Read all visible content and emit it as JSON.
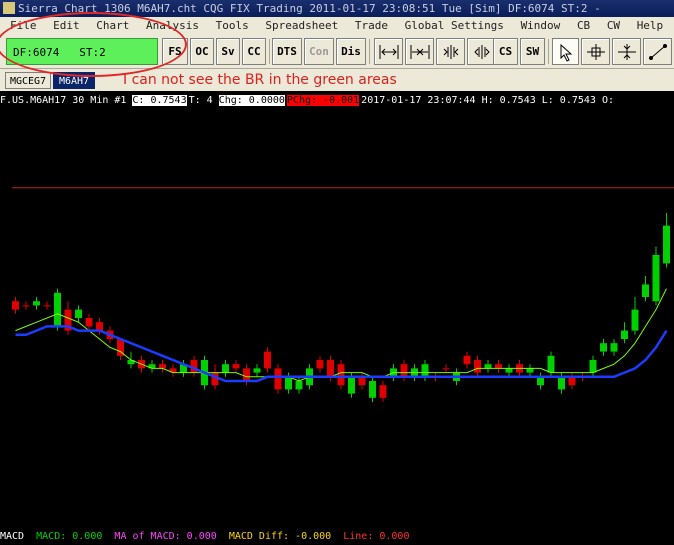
{
  "window": {
    "title": "Sierra Chart 1306 M6AH7.cht  CQG FIX Trading 2011-01-17  23:08:51 Tue [Sim]  DF:6074  ST:2 -"
  },
  "menu": [
    "File",
    "Edit",
    "Chart",
    "Analysis",
    "Tools",
    "Spreadsheet",
    "Trade",
    "Global Settings",
    "Window",
    "CB",
    "CW",
    "Help"
  ],
  "status": {
    "df": "DF:6074",
    "st": "ST:2"
  },
  "toolbar": {
    "fs": "FS",
    "oc": "OC",
    "sv": "Sv",
    "cc": "CC",
    "dts": "DTS",
    "con": "Con",
    "dis": "Dis",
    "cs": "CS",
    "sw": "SW"
  },
  "icons": {
    "expand_both": "arrows-out-icon",
    "expand_one": "arrows-in-icon",
    "zoom_in": "bar-spacing-increase-icon",
    "zoom_out": "bar-spacing-decrease-icon",
    "pointer": "cursor-pointer-icon",
    "crosshair": "crosshair-icon",
    "value": "value-tool-icon",
    "line": "line-draw-icon"
  },
  "tabs": [
    "MGCEG7",
    "M6AH7"
  ],
  "annotation_note": "I can not see the BR in the green areas",
  "chart_header": {
    "symbol": "F.US.M6AH17",
    "interval": "30 Min",
    "number": "#1",
    "close": "C: 0.7543",
    "trades": "T: 4",
    "change": "Chg: 0.0000",
    "pct_change": "PChg: -0.001",
    "datetime": "2017-01-17 23:07:44",
    "high": "H: 0.7543",
    "low": "L: 0.7543",
    "open": "O:"
  },
  "colors": {
    "up": "#00d000",
    "down": "#e00000",
    "ma_fast": "#7cfc00",
    "ma_slow": "#1a3cff",
    "hline": "#c02020",
    "green_status": "#5ef05a"
  },
  "macd": {
    "label": "MACD",
    "macd": "MACD: 0.000",
    "ma": "MA of MACD: 0.000",
    "diff": "MACD Diff: -0.000",
    "line": "Line: 0.000"
  },
  "chart_data": {
    "type": "candlestick",
    "open": [
      0.46,
      0.47,
      0.47,
      0.47,
      0.52,
      0.48,
      0.5,
      0.5,
      0.51,
      0.53,
      0.55,
      0.61,
      0.6,
      0.62,
      0.61,
      0.62,
      0.63,
      0.6,
      0.66,
      0.63,
      0.63,
      0.61,
      0.62,
      0.63,
      0.58,
      0.62,
      0.67,
      0.67,
      0.66,
      0.6,
      0.6,
      0.61,
      0.68,
      0.64,
      0.69,
      0.66,
      0.64,
      0.61,
      0.64,
      0.64,
      0.64,
      0.62,
      0.65,
      0.59,
      0.6,
      0.62,
      0.61,
      0.63,
      0.61,
      0.63,
      0.66,
      0.63,
      0.67,
      0.64,
      0.64,
      0.63,
      0.58,
      0.58,
      0.55,
      0.53,
      0.45,
      0.46,
      0.37
    ],
    "close": [
      0.48,
      0.47,
      0.46,
      0.47,
      0.44,
      0.53,
      0.48,
      0.52,
      0.53,
      0.55,
      0.59,
      0.6,
      0.62,
      0.61,
      0.62,
      0.63,
      0.61,
      0.63,
      0.6,
      0.66,
      0.61,
      0.62,
      0.65,
      0.62,
      0.62,
      0.67,
      0.64,
      0.65,
      0.62,
      0.62,
      0.64,
      0.66,
      0.64,
      0.66,
      0.65,
      0.69,
      0.62,
      0.64,
      0.62,
      0.61,
      0.64,
      0.62,
      0.63,
      0.61,
      0.63,
      0.61,
      0.62,
      0.62,
      0.63,
      0.62,
      0.64,
      0.59,
      0.64,
      0.66,
      0.64,
      0.6,
      0.56,
      0.56,
      0.53,
      0.48,
      0.42,
      0.35,
      0.28
    ],
    "high": [
      0.45,
      0.46,
      0.45,
      0.46,
      0.43,
      0.46,
      0.47,
      0.49,
      0.5,
      0.52,
      0.55,
      0.58,
      0.59,
      0.6,
      0.6,
      0.61,
      0.6,
      0.59,
      0.59,
      0.61,
      0.6,
      0.6,
      0.61,
      0.61,
      0.57,
      0.61,
      0.63,
      0.64,
      0.61,
      0.59,
      0.59,
      0.6,
      0.63,
      0.63,
      0.64,
      0.65,
      0.61,
      0.6,
      0.61,
      0.6,
      0.63,
      0.61,
      0.62,
      0.58,
      0.59,
      0.6,
      0.6,
      0.61,
      0.6,
      0.61,
      0.63,
      0.58,
      0.63,
      0.63,
      0.63,
      0.59,
      0.55,
      0.55,
      0.51,
      0.45,
      0.4,
      0.33,
      0.25
    ],
    "low": [
      0.49,
      0.48,
      0.48,
      0.48,
      0.53,
      0.54,
      0.51,
      0.53,
      0.54,
      0.56,
      0.6,
      0.62,
      0.63,
      0.63,
      0.63,
      0.64,
      0.64,
      0.64,
      0.67,
      0.67,
      0.64,
      0.63,
      0.66,
      0.64,
      0.63,
      0.68,
      0.68,
      0.68,
      0.67,
      0.63,
      0.65,
      0.67,
      0.69,
      0.67,
      0.7,
      0.7,
      0.65,
      0.65,
      0.65,
      0.65,
      0.65,
      0.63,
      0.66,
      0.62,
      0.64,
      0.63,
      0.63,
      0.64,
      0.64,
      0.64,
      0.67,
      0.64,
      0.68,
      0.67,
      0.65,
      0.64,
      0.59,
      0.59,
      0.56,
      0.54,
      0.46,
      0.47,
      0.38
    ],
    "ma_fast": [
      0.53,
      0.52,
      0.51,
      0.5,
      0.49,
      0.5,
      0.51,
      0.53,
      0.55,
      0.57,
      0.58,
      0.6,
      0.61,
      0.62,
      0.62,
      0.63,
      0.63,
      0.63,
      0.63,
      0.63,
      0.63,
      0.63,
      0.64,
      0.64,
      0.64,
      0.64,
      0.64,
      0.65,
      0.64,
      0.64,
      0.64,
      0.63,
      0.63,
      0.63,
      0.64,
      0.64,
      0.63,
      0.63,
      0.63,
      0.63,
      0.63,
      0.63,
      0.63,
      0.63,
      0.62,
      0.62,
      0.62,
      0.62,
      0.62,
      0.62,
      0.62,
      0.63,
      0.63,
      0.63,
      0.63,
      0.63,
      0.62,
      0.61,
      0.59,
      0.56,
      0.52,
      0.48,
      0.43
    ],
    "ma_slow": [
      0.54,
      0.54,
      0.53,
      0.52,
      0.52,
      0.52,
      0.53,
      0.53,
      0.53,
      0.54,
      0.55,
      0.56,
      0.57,
      0.58,
      0.59,
      0.6,
      0.61,
      0.62,
      0.63,
      0.64,
      0.65,
      0.65,
      0.65,
      0.65,
      0.64,
      0.64,
      0.64,
      0.64,
      0.64,
      0.64,
      0.64,
      0.64,
      0.64,
      0.64,
      0.64,
      0.64,
      0.64,
      0.64,
      0.64,
      0.64,
      0.64,
      0.64,
      0.64,
      0.64,
      0.64,
      0.64,
      0.64,
      0.64,
      0.64,
      0.64,
      0.64,
      0.64,
      0.64,
      0.64,
      0.64,
      0.64,
      0.64,
      0.64,
      0.63,
      0.62,
      0.6,
      0.57,
      0.53
    ],
    "hline": 0.19
  }
}
